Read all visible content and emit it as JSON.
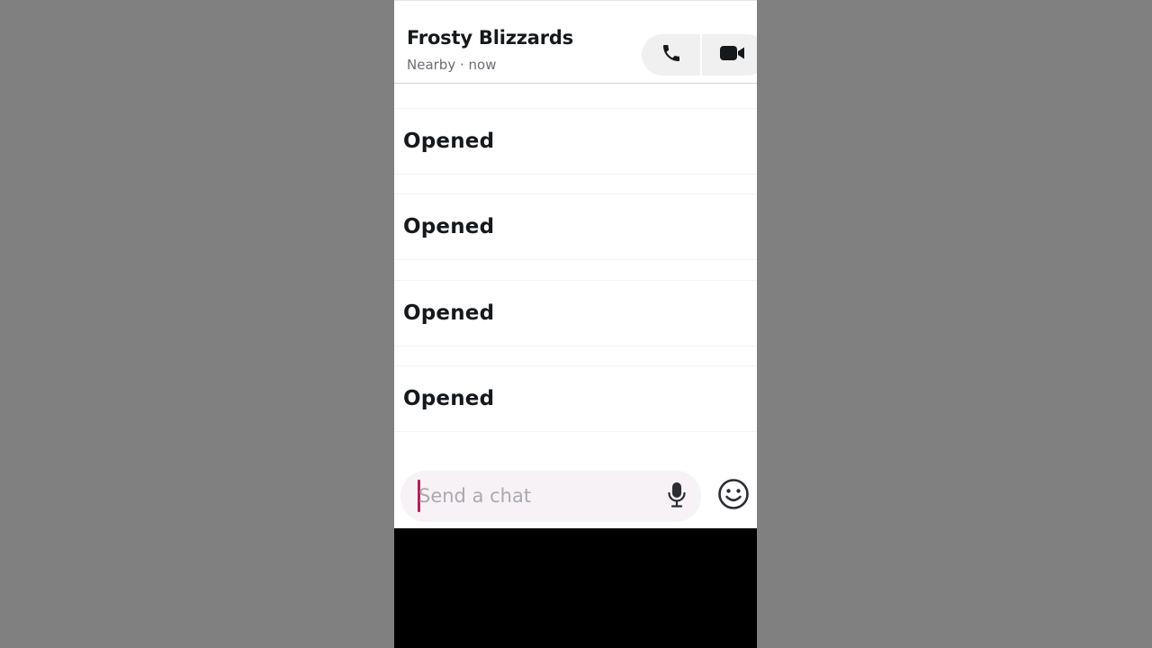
{
  "header": {
    "contact_name": "Frosty Blizzards",
    "status": "Nearby · now",
    "call_icon": "phone-icon",
    "video_icon": "video-camera-icon"
  },
  "messages": [
    {
      "label": "Opened"
    },
    {
      "label": "Opened"
    },
    {
      "label": "Opened"
    },
    {
      "label": "Opened"
    }
  ],
  "composer": {
    "placeholder": "Send a chat",
    "value": "",
    "mic_icon": "microphone-icon",
    "emoji_icon": "smiley-face-icon"
  },
  "colors": {
    "backdrop": "#808080",
    "caret": "#c2185b",
    "input_background": "#f7f2f6",
    "call_group_background": "#f0f0f1"
  }
}
